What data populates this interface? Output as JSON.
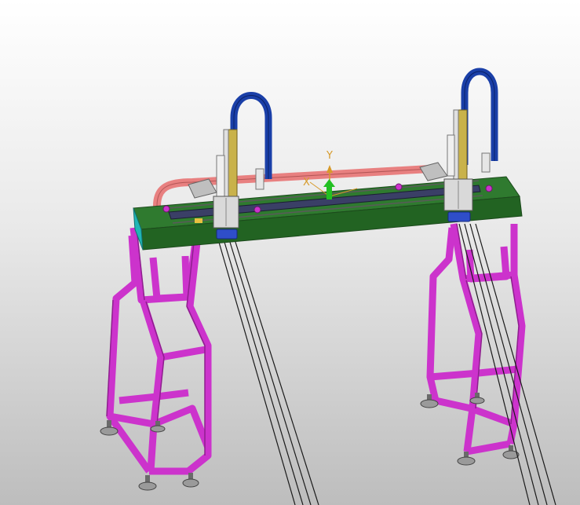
{
  "viewport": {
    "axis_labels": {
      "y": "Y",
      "x": "X"
    }
  },
  "colors": {
    "frame": "#cc33cc",
    "frame_dark": "#8e1f8e",
    "beam_top": "#2f7a2f",
    "beam_front": "#226322",
    "beam_end": "#21b6b6",
    "hose": "#e88080",
    "cable_loop": "#1a3fa8",
    "carriage": "#d9d9d9",
    "screw": "#c9b24a",
    "cable": "#1a1a1a",
    "foot": "#9a9a9a",
    "axis_y": "#d79a2a",
    "axis_arrow": "#22c022"
  }
}
